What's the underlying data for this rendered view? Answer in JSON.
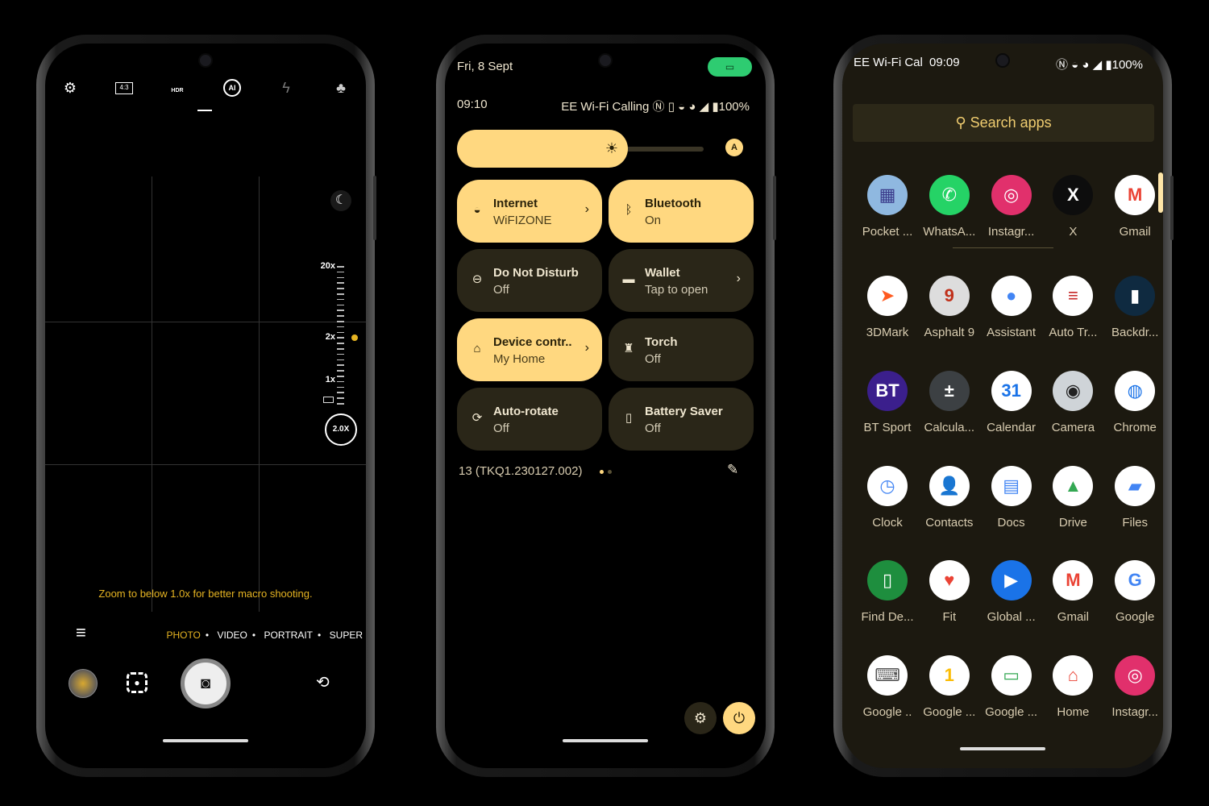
{
  "camera": {
    "top_icons": [
      "gear-icon",
      "aspect-ratio-icon",
      "hdr-auto-icon",
      "ai-scene-icon",
      "flash-off-icon",
      "filters-icon"
    ],
    "aspect_ratio": "4:3",
    "hdr": "HDR",
    "ai": "AI",
    "zoom_labels": [
      "20x",
      "2x",
      "1x"
    ],
    "zoom_value": "2.0X",
    "macro_hint": "Zoom to below 1.0x for better macro shooting.",
    "modes": [
      "PHOTO",
      "VIDEO",
      "PORTRAIT",
      "SUPER"
    ],
    "active_mode": "PHOTO",
    "accent": "#e6b422"
  },
  "qs": {
    "date": "Fri, 8 Sept",
    "time": "09:10",
    "carrier": "EE Wi-Fi Calling",
    "battery": "100%",
    "brightness_level": 0.7,
    "tiles": [
      {
        "title": "Internet",
        "sub": "WiFIZONE",
        "icon": "wifi-icon",
        "on": true,
        "chevron": true
      },
      {
        "title": "Bluetooth",
        "sub": "On",
        "icon": "bluetooth-icon",
        "on": true,
        "chevron": false
      },
      {
        "title": "Do Not Disturb",
        "sub": "Off",
        "icon": "dnd-icon",
        "on": false,
        "chevron": false
      },
      {
        "title": "Wallet",
        "sub": "Tap to open",
        "icon": "wallet-icon",
        "on": false,
        "chevron": true
      },
      {
        "title": "Device contr..",
        "sub": "My Home",
        "icon": "home-icon",
        "on": true,
        "chevron": true
      },
      {
        "title": "Torch",
        "sub": "Off",
        "icon": "torch-icon",
        "on": false,
        "chevron": false
      },
      {
        "title": "Auto-rotate",
        "sub": "Off",
        "icon": "rotate-icon",
        "on": false,
        "chevron": false
      },
      {
        "title": "Battery Saver",
        "sub": "Off",
        "icon": "battery-saver-icon",
        "on": false,
        "chevron": false
      }
    ],
    "build": "13 (TKQ1.230127.002)",
    "accent": "#ffd880",
    "camera_chip_color": "#2ecc71"
  },
  "drawer": {
    "carrier": "EE Wi-Fi Cal",
    "time": "09:09",
    "battery": "100%",
    "search_placeholder": "Search apps",
    "apps": [
      {
        "label": "Pocket ...",
        "bg": "#8fb8e0",
        "fg": "#3a3a8a",
        "g": "▦"
      },
      {
        "label": "WhatsA...",
        "bg": "#25d366",
        "fg": "#fff",
        "g": "✆"
      },
      {
        "label": "Instagr...",
        "bg": "#e1306c",
        "fg": "#fff",
        "g": "◎"
      },
      {
        "label": "X",
        "bg": "#0d0d0d",
        "fg": "#fff",
        "g": "X"
      },
      {
        "label": "Gmail",
        "bg": "#fff",
        "fg": "#ea4335",
        "g": "M"
      },
      {
        "label": "3DMark",
        "bg": "#fff",
        "fg": "#ff5a1f",
        "g": "➤"
      },
      {
        "label": "Asphalt 9",
        "bg": "#ddd",
        "fg": "#c0301a",
        "g": "9"
      },
      {
        "label": "Assistant",
        "bg": "#fff",
        "fg": "#4285f4",
        "g": "●"
      },
      {
        "label": "Auto Tr...",
        "bg": "#fff",
        "fg": "#c62828",
        "g": "≡"
      },
      {
        "label": "Backdr...",
        "bg": "#0f2a40",
        "fg": "#fff",
        "g": "▮"
      },
      {
        "label": "BT Sport",
        "bg": "#3b1f8c",
        "fg": "#fff",
        "g": "BT"
      },
      {
        "label": "Calcula...",
        "bg": "#3c4043",
        "fg": "#fff",
        "g": "±"
      },
      {
        "label": "Calendar",
        "bg": "#fff",
        "fg": "#1a73e8",
        "g": "31"
      },
      {
        "label": "Camera",
        "bg": "#cfd4d8",
        "fg": "#222",
        "g": "◉"
      },
      {
        "label": "Chrome",
        "bg": "#fff",
        "fg": "#1a73e8",
        "g": "◍"
      },
      {
        "label": "Clock",
        "bg": "#fff",
        "fg": "#4285f4",
        "g": "◷"
      },
      {
        "label": "Contacts",
        "bg": "#fff",
        "fg": "#1a73e8",
        "g": "👤"
      },
      {
        "label": "Docs",
        "bg": "#fff",
        "fg": "#4285f4",
        "g": "▤"
      },
      {
        "label": "Drive",
        "bg": "#fff",
        "fg": "#34a853",
        "g": "▲"
      },
      {
        "label": "Files",
        "bg": "#fff",
        "fg": "#4285f4",
        "g": "▰"
      },
      {
        "label": "Find De...",
        "bg": "#1e8e3e",
        "fg": "#fff",
        "g": "▯"
      },
      {
        "label": "Fit",
        "bg": "#fff",
        "fg": "#ea4335",
        "g": "♥"
      },
      {
        "label": "Global ...",
        "bg": "#1a73e8",
        "fg": "#fff",
        "g": "▶"
      },
      {
        "label": "Gmail",
        "bg": "#fff",
        "fg": "#ea4335",
        "g": "M"
      },
      {
        "label": "Google",
        "bg": "#fff",
        "fg": "#4285f4",
        "g": "G"
      },
      {
        "label": "Google ..",
        "bg": "#fff",
        "fg": "#555",
        "g": "⌨"
      },
      {
        "label": "Google ...",
        "bg": "#fff",
        "fg": "#fbbc04",
        "g": "1"
      },
      {
        "label": "Google ...",
        "bg": "#fff",
        "fg": "#34a853",
        "g": "▭"
      },
      {
        "label": "Home",
        "bg": "#fff",
        "fg": "#ea4335",
        "g": "⌂"
      },
      {
        "label": "Instagr...",
        "bg": "#e1306c",
        "fg": "#fff",
        "g": "◎"
      }
    ],
    "bg": "#1c1910"
  }
}
